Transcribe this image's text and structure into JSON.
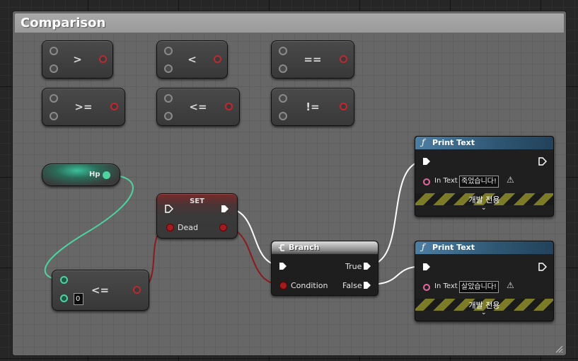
{
  "comment": {
    "title": "Comparison"
  },
  "ops": {
    "gt": ">",
    "lt": "<",
    "eq": "==",
    "ge": ">=",
    "le": "<=",
    "ne": "!="
  },
  "hp_node": {
    "label": "Hp"
  },
  "set_node": {
    "title": "SET",
    "pin_label": "Dead"
  },
  "le_node": {
    "value": "0",
    "op": "<="
  },
  "branch": {
    "title": "Branch",
    "condition": "Condition",
    "true_label": "True",
    "false_label": "False"
  },
  "print1": {
    "title": "Print Text",
    "in_label": "In Text",
    "text": "죽었습니다!",
    "dev_label": "개발 전용"
  },
  "print2": {
    "title": "Print Text",
    "in_label": "In Text",
    "text": "살았습니다!",
    "dev_label": "개발 전용"
  },
  "colors": {
    "exec": "#ffffff",
    "bool": "#a01e22",
    "float": "#4fd3a0",
    "function_header": "#4d7ea3",
    "dev_only": "#7b7b28"
  },
  "icons": [
    "function-icon",
    "branch-icon",
    "warning-icon",
    "chevron-down-icon",
    "resize-grip-icon"
  ]
}
